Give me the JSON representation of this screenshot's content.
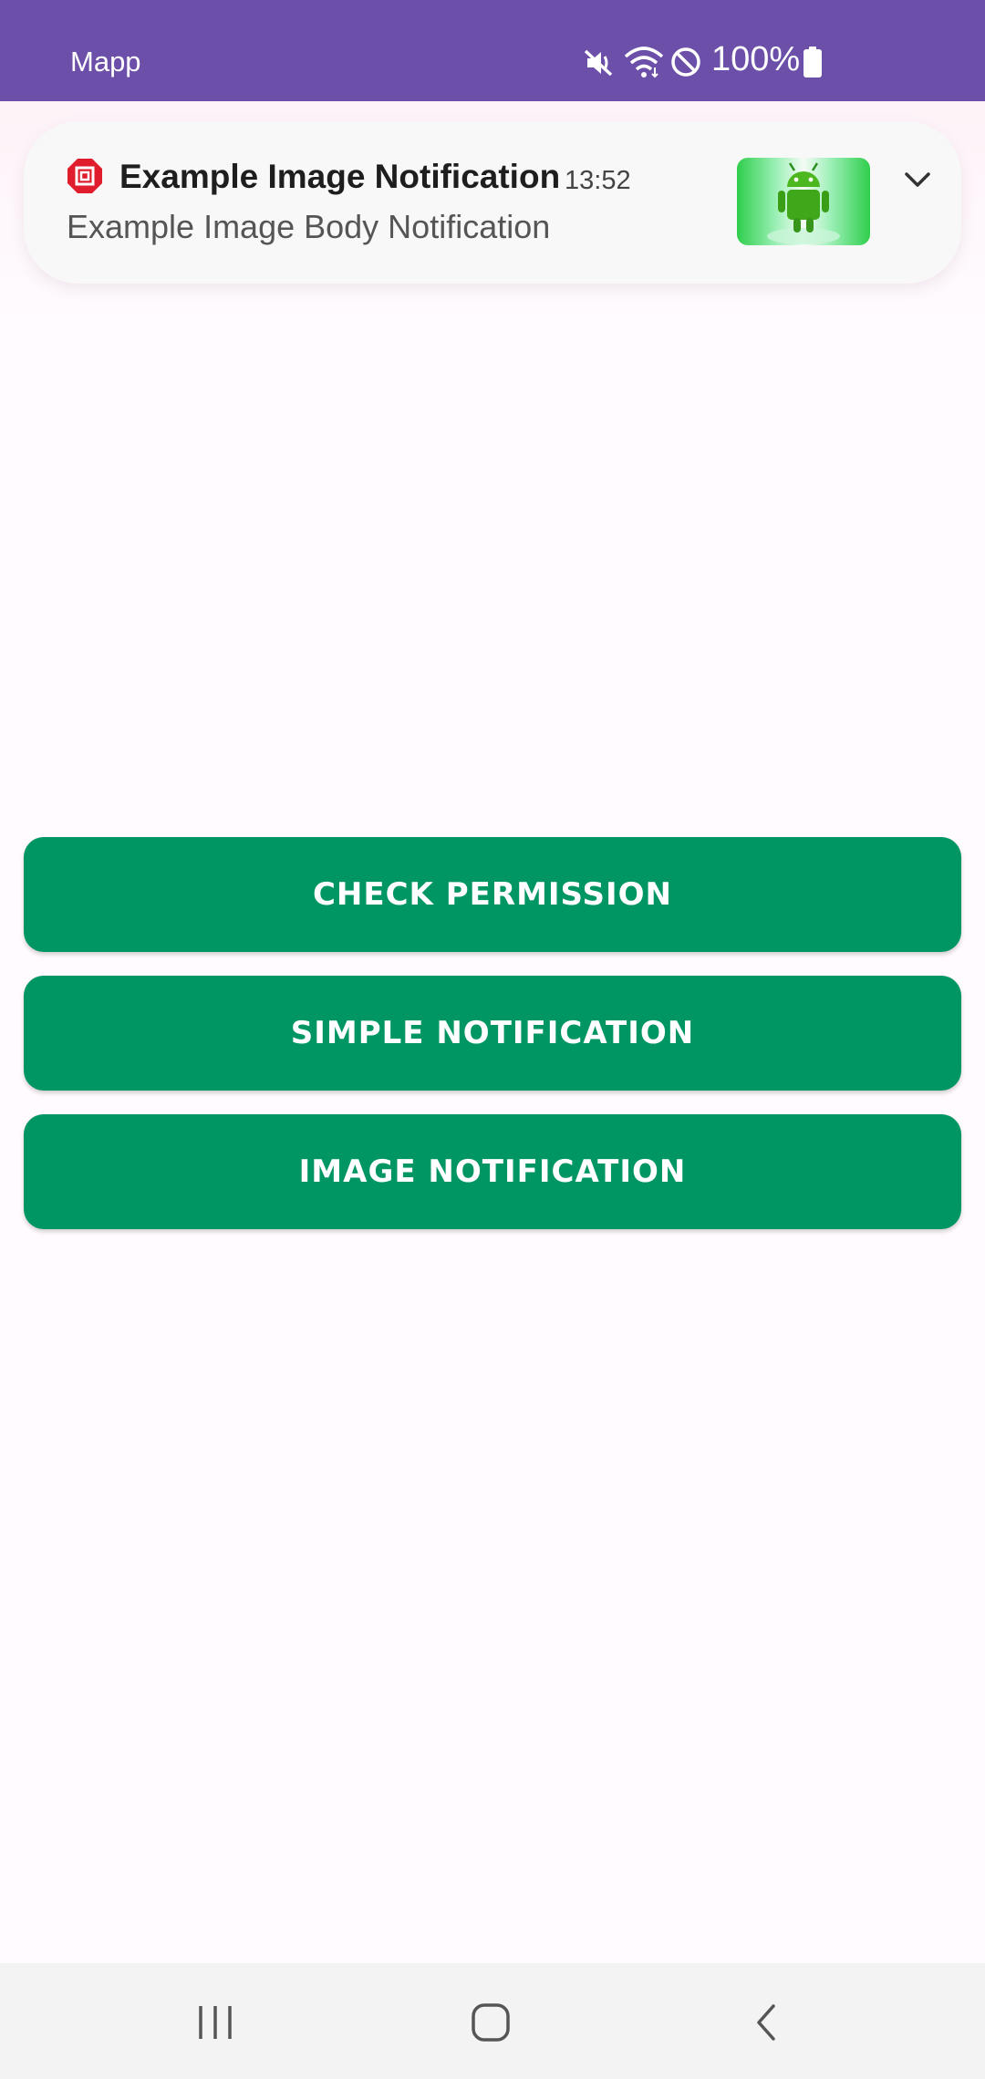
{
  "status_bar": {
    "app_name": "Mapp",
    "battery_percent": "100%",
    "background_color": "#6b4fa8",
    "icons": [
      "mute-icon",
      "wifi-icon",
      "do-not-disturb-icon",
      "battery-icon"
    ]
  },
  "notification": {
    "app_icon": "mapp-app-icon",
    "title": "Example Image Notification",
    "time": "13:52",
    "body": "Example Image Body Notification",
    "image": "android-robot-thumbnail",
    "expand_icon": "chevron-down-icon"
  },
  "buttons": {
    "check_permission": "CHECK PERMISSION",
    "simple_notification": "SIMPLE NOTIFICATION",
    "image_notification": "IMAGE NOTIFICATION",
    "color": "#009664"
  },
  "nav_bar": {
    "icons": [
      "recents-icon",
      "home-icon",
      "back-icon"
    ]
  }
}
